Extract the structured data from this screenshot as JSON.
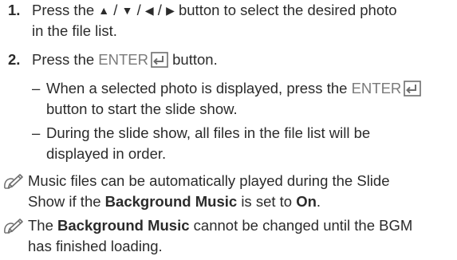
{
  "steps": [
    {
      "number": "1.",
      "text_before": "Press the",
      "buttons": [
        "▲",
        "▼",
        "◀",
        "▶"
      ],
      "separator": "/",
      "text_line1_after": "button to select the desired photo",
      "text_line2": "in the file list."
    },
    {
      "number": "2.",
      "text_before": "Press the",
      "key": "ENTER",
      "text_after": "button."
    }
  ],
  "sub_items": [
    {
      "dash": "–",
      "line1_before": "When a selected photo is displayed, press the",
      "key": "ENTER",
      "line2": "button to start the slide show."
    },
    {
      "dash": "–",
      "line1": "During the slide show, all files in the file list will be",
      "line2": "displayed in order."
    }
  ],
  "notes": [
    {
      "line1": "Music files can be automatically played during the Slide",
      "line2_before": "Show if the",
      "bold1": "Background Music",
      "line2_mid": "is set to",
      "bold2": "On",
      "line2_end": "."
    },
    {
      "line1_before": "The",
      "bold1": "Background Music",
      "line1_after": "cannot be changed until the BGM",
      "line2": "has finished loading."
    }
  ],
  "colors": {
    "text": "#2b2b2b",
    "keyword": "#7a7a7a",
    "icon": "#6e6e6e"
  },
  "icons": [
    "note-pencil-icon",
    "enter-key-icon"
  ]
}
